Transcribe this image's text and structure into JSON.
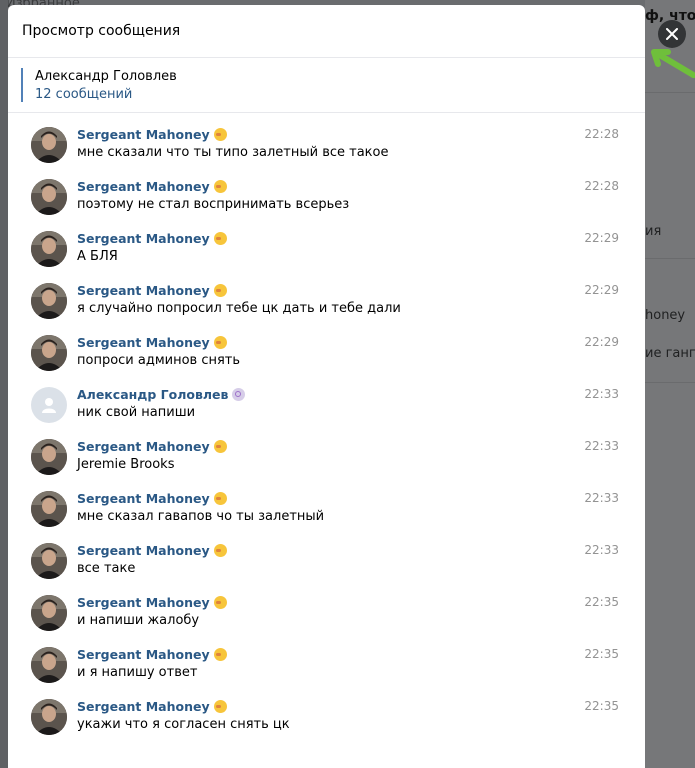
{
  "background": {
    "top_left_text": "Избранное",
    "right_top_text": "ф, что ей",
    "right_items": [
      "ия",
      "honey",
      "ие гангст"
    ]
  },
  "modal": {
    "title": "Просмотр сообщения",
    "conversation": {
      "name": "Александр Головлев",
      "count": "12 сообщений"
    },
    "close_icon": "close-icon"
  },
  "messages": [
    {
      "author": "Sergeant Mahoney",
      "emoji": "duck",
      "text": "мне сказали что ты типо залетный все такое",
      "time": "22:28",
      "avatar": "photo"
    },
    {
      "author": "Sergeant Mahoney",
      "emoji": "duck",
      "text": "поэтому не стал воспринимать всерьез",
      "time": "22:28",
      "avatar": "photo"
    },
    {
      "author": "Sergeant Mahoney",
      "emoji": "duck",
      "text": "А БЛЯ",
      "time": "22:29",
      "avatar": "photo"
    },
    {
      "author": "Sergeant Mahoney",
      "emoji": "duck",
      "text": "я случайно попросил тебе цк дать и тебе дали",
      "time": "22:29",
      "avatar": "photo"
    },
    {
      "author": "Sergeant Mahoney",
      "emoji": "duck",
      "text": "попроси админов снять",
      "time": "22:29",
      "avatar": "photo"
    },
    {
      "author": "Александр Головлев",
      "emoji": "swirl",
      "text": "ник свой напиши",
      "time": "22:33",
      "avatar": "default"
    },
    {
      "author": "Sergeant Mahoney",
      "emoji": "duck",
      "text": "Jeremie Brooks",
      "time": "22:33",
      "avatar": "photo"
    },
    {
      "author": "Sergeant Mahoney",
      "emoji": "duck",
      "text": "мне сказал гавапов чо ты залетный",
      "time": "22:33",
      "avatar": "photo"
    },
    {
      "author": "Sergeant Mahoney",
      "emoji": "duck",
      "text": "все таке",
      "time": "22:33",
      "avatar": "photo"
    },
    {
      "author": "Sergeant Mahoney",
      "emoji": "duck",
      "text": "и напиши жалобу",
      "time": "22:35",
      "avatar": "photo"
    },
    {
      "author": "Sergeant Mahoney",
      "emoji": "duck",
      "text": "и я напишу ответ",
      "time": "22:35",
      "avatar": "photo"
    },
    {
      "author": "Sergeant Mahoney",
      "emoji": "duck",
      "text": "укажи что я согласен снять цк",
      "time": "22:35",
      "avatar": "photo"
    }
  ],
  "colors": {
    "link": "#2a5885",
    "accent_bar": "#5181b8",
    "time": "#939393"
  }
}
